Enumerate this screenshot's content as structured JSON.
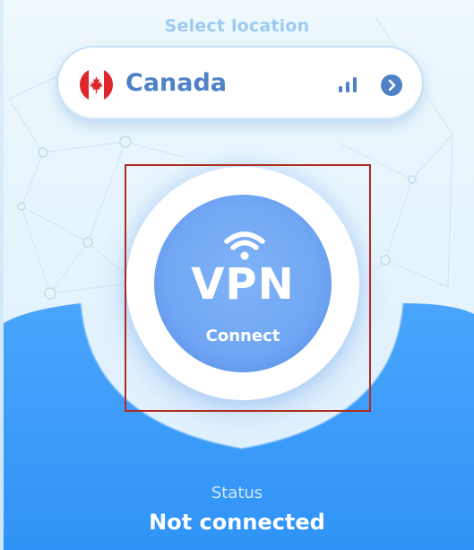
{
  "header": {
    "select_location_label": "Select location"
  },
  "location": {
    "country": "Canada",
    "flag": "canada-flag",
    "signal_icon": "signal-bars-icon",
    "chevron_icon": "chevron-right-icon"
  },
  "connect": {
    "icon": "wifi-icon",
    "logo_text": "VPN",
    "label": "Connect"
  },
  "status": {
    "label": "Status",
    "value": "Not connected"
  },
  "colors": {
    "accent": "#4f81c6",
    "button": "#6ea4f3",
    "panel": "#4aa5fb",
    "highlight": "#b22a1f"
  }
}
